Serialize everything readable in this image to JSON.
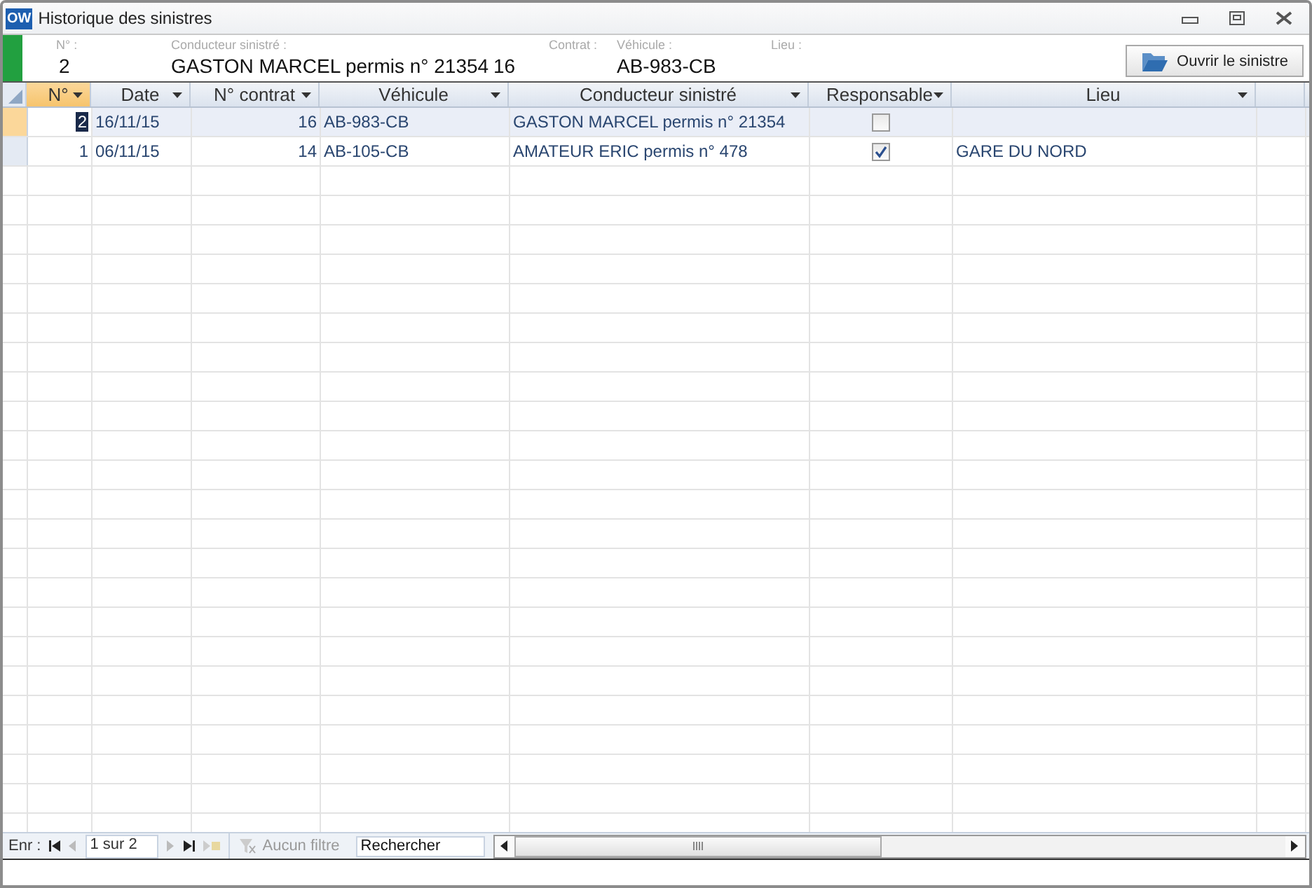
{
  "window": {
    "title": "Historique des sinistres",
    "app_badge": "OW"
  },
  "header": {
    "fields": [
      {
        "label": "N° :",
        "value": "2"
      },
      {
        "label": "Conducteur sinistré :",
        "value": "GASTON MARCEL permis n° 21354"
      },
      {
        "label": "Contrat :",
        "value": "16"
      },
      {
        "label": "Véhicule :",
        "value": "AB-983-CB"
      },
      {
        "label": "Lieu :"
      }
    ],
    "button": "Ouvrir le sinistre"
  },
  "table": {
    "columns": [
      "N°",
      "Date",
      "N° contrat",
      "Véhicule",
      "Conducteur sinistré",
      "Responsable",
      "Lieu"
    ],
    "rows": [
      {
        "selected": true,
        "num": "2",
        "date": "16/11/15",
        "contract": "16",
        "vehicle": "AB-983-CB",
        "driver": "GASTON MARCEL permis n° 21354",
        "responsible": false
      },
      {
        "selected": false,
        "num": "1",
        "date": "06/11/15",
        "contract": "14",
        "vehicle": "AB-105-CB",
        "driver": "AMATEUR ERIC permis n° 478",
        "responsible": true,
        "place": "GARE DU NORD"
      }
    ]
  },
  "navigation": {
    "label": "Enr :",
    "position": "1 sur  2",
    "filter": "Aucun filtre",
    "search_placeholder": "Rechercher"
  }
}
